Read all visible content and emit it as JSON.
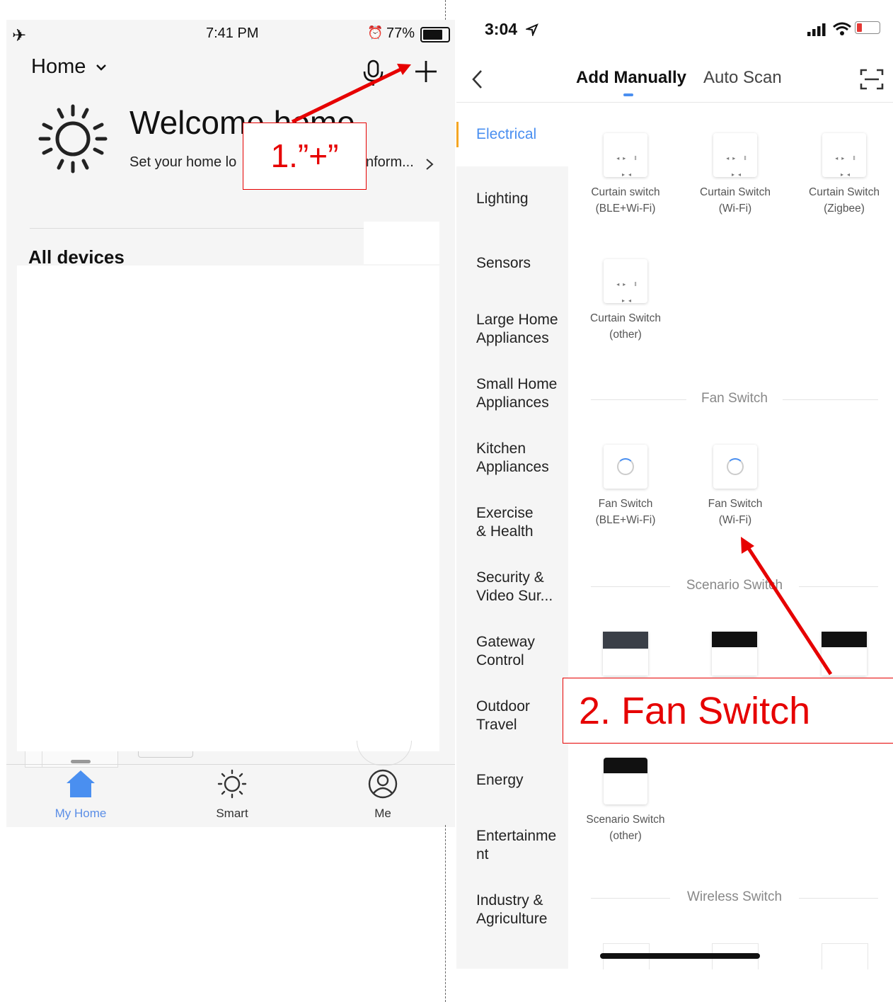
{
  "left_phone": {
    "status": {
      "time": "7:41 PM",
      "battery": "77%"
    },
    "header": {
      "home_label": "Home"
    },
    "welcome": {
      "title": "Welcome home",
      "subtitle_start": "Set your home lo",
      "subtitle_end": "nform..."
    },
    "section": {
      "all_devices": "All devices"
    },
    "tabbar": [
      {
        "label": "My Home",
        "active": true
      },
      {
        "label": "Smart",
        "active": false
      },
      {
        "label": "Me",
        "active": false
      }
    ]
  },
  "right_phone": {
    "status": {
      "time": "3:04"
    },
    "nav": {
      "tab_manual": "Add Manually",
      "tab_scan": "Auto Scan"
    },
    "categories": [
      {
        "label": "Electrical",
        "active": true
      },
      {
        "label": "Lighting"
      },
      {
        "label": "Sensors"
      },
      {
        "label": "Large Home Appliances"
      },
      {
        "label": "Small Home Appliances"
      },
      {
        "label": "Kitchen Appliances"
      },
      {
        "label": "Exercise & Health"
      },
      {
        "label": "Security & Video Sur..."
      },
      {
        "label": "Gateway Control"
      },
      {
        "label": "Outdoor Travel"
      },
      {
        "label": "Energy"
      },
      {
        "label": "Entertainment"
      },
      {
        "label": "Industry & Agriculture"
      }
    ],
    "devices": {
      "curtain": [
        {
          "name": "Curtain switch",
          "sub": "(BLE+Wi-Fi)"
        },
        {
          "name": "Curtain Switch",
          "sub": "(Wi-Fi)"
        },
        {
          "name": "Curtain Switch",
          "sub": "(Zigbee)"
        },
        {
          "name": "Curtain Switch",
          "sub": "(other)"
        }
      ],
      "fan_section": "Fan Switch",
      "fan": [
        {
          "name": "Fan Switch",
          "sub": "(BLE+Wi-Fi)"
        },
        {
          "name": "Fan Switch",
          "sub": "(Wi-Fi)"
        }
      ],
      "scenario_section": "Scenario Switch",
      "scenario_other": {
        "name": "Scenario Switch",
        "sub": "(other)"
      },
      "wireless_section": "Wireless Switch"
    }
  },
  "annotations": {
    "step1": "1.”+”",
    "step2": "2. Fan Switch",
    "color": "#e60000"
  },
  "colors": {
    "accent": "#4a8ff0",
    "active_tab": "#5b8ee6"
  }
}
